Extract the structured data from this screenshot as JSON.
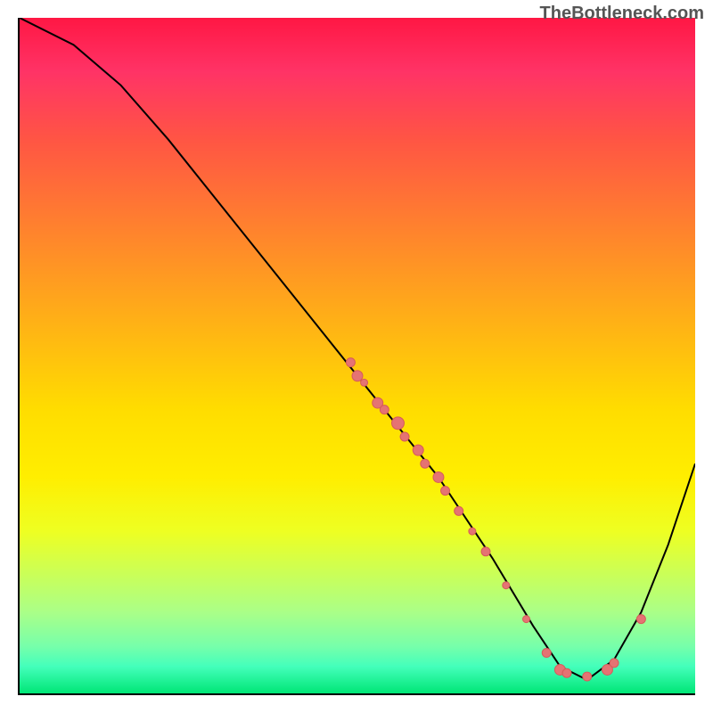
{
  "watermark": "TheBottleneck.com",
  "chart_data": {
    "type": "line",
    "title": "",
    "xlabel": "",
    "ylabel": "",
    "xlim": [
      0,
      100
    ],
    "ylim": [
      0,
      100
    ],
    "gradient_background": true,
    "curve_points": [
      {
        "x": 0,
        "y": 100
      },
      {
        "x": 8,
        "y": 96
      },
      {
        "x": 15,
        "y": 90
      },
      {
        "x": 22,
        "y": 82
      },
      {
        "x": 30,
        "y": 72
      },
      {
        "x": 38,
        "y": 62
      },
      {
        "x": 46,
        "y": 52
      },
      {
        "x": 54,
        "y": 42
      },
      {
        "x": 62,
        "y": 32
      },
      {
        "x": 70,
        "y": 20
      },
      {
        "x": 76,
        "y": 10
      },
      {
        "x": 80,
        "y": 4
      },
      {
        "x": 84,
        "y": 2
      },
      {
        "x": 88,
        "y": 5
      },
      {
        "x": 92,
        "y": 12
      },
      {
        "x": 96,
        "y": 22
      },
      {
        "x": 100,
        "y": 34
      }
    ],
    "scatter_points": [
      {
        "x": 49,
        "y": 49,
        "r": 5
      },
      {
        "x": 50,
        "y": 47,
        "r": 6
      },
      {
        "x": 51,
        "y": 46,
        "r": 4
      },
      {
        "x": 53,
        "y": 43,
        "r": 6
      },
      {
        "x": 54,
        "y": 42,
        "r": 5
      },
      {
        "x": 56,
        "y": 40,
        "r": 7
      },
      {
        "x": 57,
        "y": 38,
        "r": 5
      },
      {
        "x": 59,
        "y": 36,
        "r": 6
      },
      {
        "x": 60,
        "y": 34,
        "r": 5
      },
      {
        "x": 62,
        "y": 32,
        "r": 6
      },
      {
        "x": 63,
        "y": 30,
        "r": 5
      },
      {
        "x": 65,
        "y": 27,
        "r": 5
      },
      {
        "x": 67,
        "y": 24,
        "r": 4
      },
      {
        "x": 69,
        "y": 21,
        "r": 5
      },
      {
        "x": 72,
        "y": 16,
        "r": 4
      },
      {
        "x": 75,
        "y": 11,
        "r": 4
      },
      {
        "x": 78,
        "y": 6,
        "r": 5
      },
      {
        "x": 80,
        "y": 3.5,
        "r": 6
      },
      {
        "x": 81,
        "y": 3,
        "r": 5
      },
      {
        "x": 84,
        "y": 2.5,
        "r": 5
      },
      {
        "x": 87,
        "y": 3.5,
        "r": 6
      },
      {
        "x": 88,
        "y": 4.5,
        "r": 5
      },
      {
        "x": 92,
        "y": 11,
        "r": 5
      }
    ]
  }
}
